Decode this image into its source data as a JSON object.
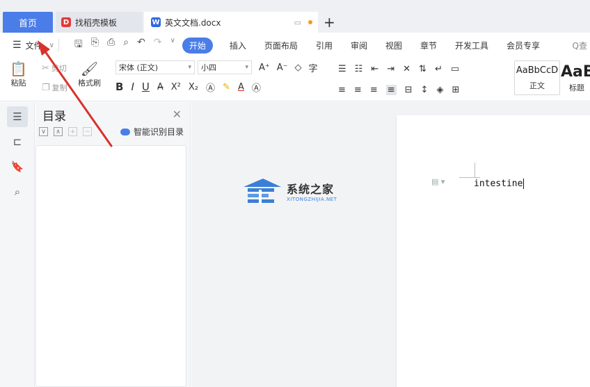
{
  "tabs": {
    "home": "首页",
    "templates": "找稻壳模板",
    "document": "英文文档.docx",
    "plus": "+"
  },
  "menu": {
    "file": "文件",
    "tabs": [
      "开始",
      "插入",
      "页面布局",
      "引用",
      "审阅",
      "视图",
      "章节",
      "开发工具",
      "会员专享"
    ],
    "active_index": 0,
    "search_partial": "Q查"
  },
  "ribbon": {
    "paste": "粘贴",
    "cut": "剪切",
    "copy": "复制",
    "format_painter": "格式刷",
    "font_name": "宋体 (正文)",
    "font_size": "小四",
    "styles": [
      {
        "sample": "AaBbCcD",
        "label": "正文"
      },
      {
        "sample": "AaB",
        "label": "标题"
      }
    ]
  },
  "toc": {
    "title": "目录",
    "smart_button": "智能识别目录"
  },
  "document": {
    "text": "intestine"
  },
  "watermark": {
    "cn": "系统之家",
    "en": "XITONGZHIJIA.NET"
  },
  "colors": {
    "accent": "#4a7de8",
    "arrow": "#d9312b"
  }
}
